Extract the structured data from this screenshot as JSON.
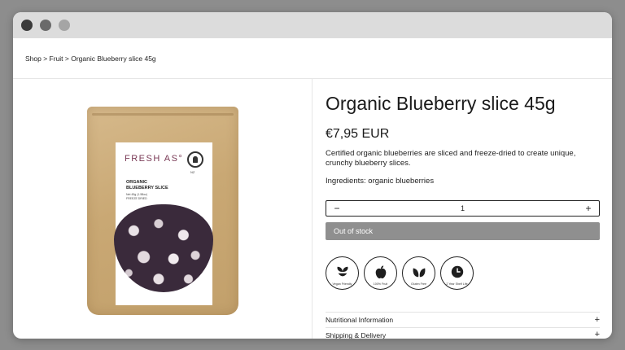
{
  "breadcrumb": [
    "Shop",
    " > ",
    "Fruit",
    " > ",
    "Organic Blueberry slice 45g"
  ],
  "product": {
    "title": "Organic Blueberry slice 45g",
    "price": "€7,95 EUR",
    "description": "Certified organic blueberries are sliced and freeze-dried to create unique, crunchy blueberry slices.",
    "ingredients": "Ingredients: organic blueberries",
    "quantity": "1",
    "decrease_symbol": "−",
    "increase_symbol": "+",
    "stock_button": "Out of stock"
  },
  "packaging": {
    "brand": "FRESH AS°",
    "line1": "ORGANIC",
    "line2": "BLUEBERRY SLICE",
    "small1": "Net 45g (1.58oz)",
    "small2": "FREEZE DRIED",
    "seal_year": "NZ",
    "label_color": "#7a3a56"
  },
  "badges": [
    {
      "icon": "seedling-icon",
      "label": "Vegan Friendly"
    },
    {
      "icon": "apple-icon",
      "label": "100% Fruit"
    },
    {
      "icon": "leaf-icon",
      "label": "Gluten Free"
    },
    {
      "icon": "clock-icon",
      "label": "2 Year Shelf Life"
    }
  ],
  "accordion": [
    {
      "label": "Nutritional Information",
      "symbol": "+"
    },
    {
      "label": "Shipping & Delivery",
      "symbol": "+"
    }
  ],
  "colors": {
    "background": "#8d8d8d",
    "titlebar": "#dcdcdc",
    "out_of_stock_bg": "#8f8f8f"
  }
}
